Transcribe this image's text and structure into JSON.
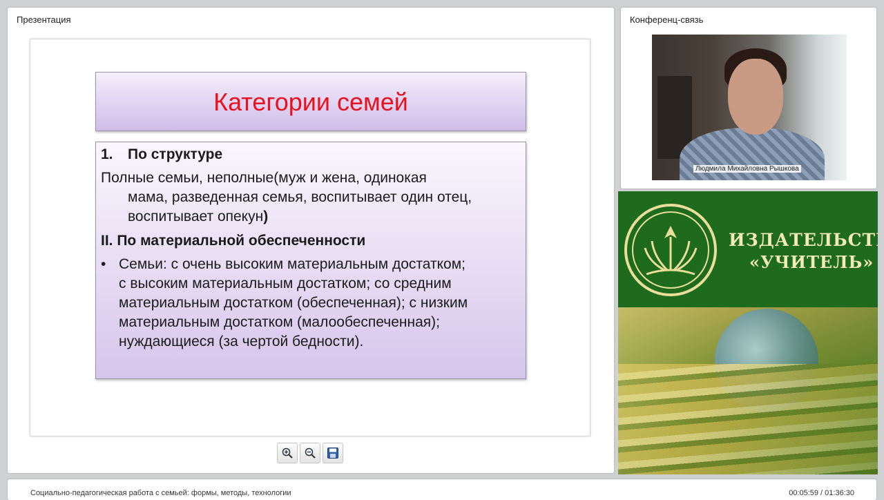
{
  "presentation_panel": {
    "title": "Презентация"
  },
  "slide": {
    "title": "Категории семей",
    "section1_number": "1.",
    "section1_heading": "По структуре",
    "section1_lines": [
      "Полные семьи, неполные(муж и жена, одинокая",
      "мама, разведенная семья, воспитывает один отец,",
      "воспитывает опекун",
      ")"
    ],
    "section2_heading": "II. По материальной обеспеченности",
    "bullet": "•",
    "section2_lines": [
      "Семьи: с очень высоким материальным достатком;",
      "с высоким материальным достатком; со средним",
      "материальным достатком (обеспеченная); с низким",
      "материальным достатком (малообеспеченная);",
      "нуждающиеся (за чертой бедности)."
    ],
    "colors": {
      "title": "#e8121f",
      "box_top": "#f5f0fb",
      "box_bottom": "#d0bde8"
    }
  },
  "toolbar": {
    "icons": [
      "zoom-in-icon",
      "zoom-out-icon",
      "save-icon"
    ]
  },
  "conference_panel": {
    "title": "Конференц-связь",
    "participant_name": "Людмила Михайловна Рышкова"
  },
  "banner": {
    "line1": "ИЗДАТЕЛЬСТВО",
    "line2": "«УЧИТЕЛЬ»",
    "colors": {
      "green": "#1e6b1e",
      "text": "#f3ebb5"
    }
  },
  "bottom_bar": {
    "course_title": "Социально-педагогическая работа с семьей: формы, методы, технологии",
    "time": "00:05:59 / 01:36:30"
  }
}
